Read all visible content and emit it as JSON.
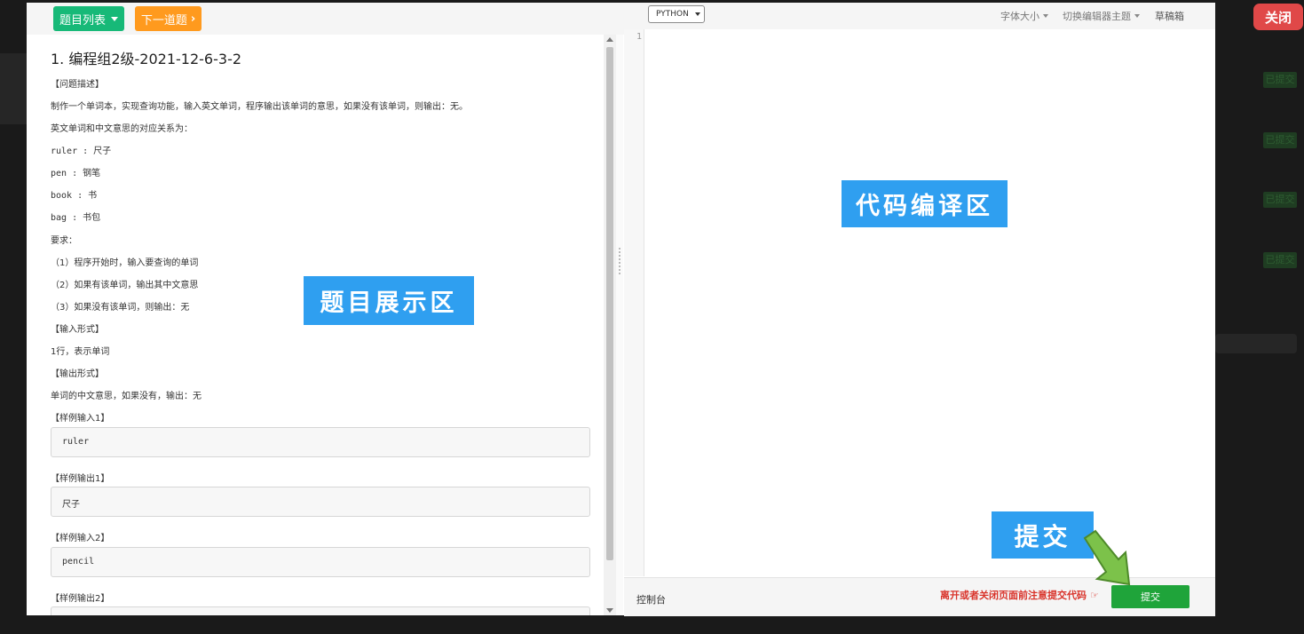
{
  "background": {
    "badges": [
      "已提交",
      "已提交",
      "已提交",
      "已提交"
    ],
    "close_label": "关闭"
  },
  "toolbar": {
    "problem_list_label": "题目列表",
    "next_problem_label": "下一道题"
  },
  "problem": {
    "title": "1. 编程组2级-2021-12-6-3-2",
    "lines": [
      "【问题描述】",
      "制作一个单词本，实现查询功能，输入英文单词，程序输出该单词的意思，如果没有该单词，则输出：无。",
      "英文单词和中文意思的对应关系为：",
      "ruler : 尺子",
      "pen : 钢笔",
      "book : 书",
      "bag : 书包",
      "要求：",
      "（1）程序开始时，输入要查询的单词",
      "（2）如果有该单词，输出其中文意思",
      "（3）如果没有该单词，则输出：无",
      "【输入形式】",
      "1行，表示单词",
      "【输出形式】",
      "单词的中文意思，如果没有，输出：无"
    ],
    "samples": {
      "input1_label": "【样例输入1】",
      "input1": "ruler",
      "output1_label": "【样例输出1】",
      "output1": "尺子",
      "input2_label": "【样例输入2】",
      "input2": "pencil",
      "output2_label": "【样例输出2】"
    }
  },
  "editor": {
    "language": "PYTHON",
    "font_size_label": "字体大小",
    "theme_label": "切换编辑器主题",
    "draft_label": "草稿箱",
    "line_number": "1"
  },
  "console": {
    "label": "控制台",
    "warning": "离开或者关闭页面前注意提交代码",
    "submit_label": "提交"
  },
  "annotations": {
    "problem_area": "题目展示区",
    "code_area": "代码编译区",
    "submit": "提交"
  },
  "colors": {
    "green_button": "#17b978",
    "orange_button": "#ff9a1e",
    "submit_button": "#1fa43a",
    "callout": "#2f9ff0",
    "close_button": "#e04848",
    "warning_text": "#d9342b"
  }
}
